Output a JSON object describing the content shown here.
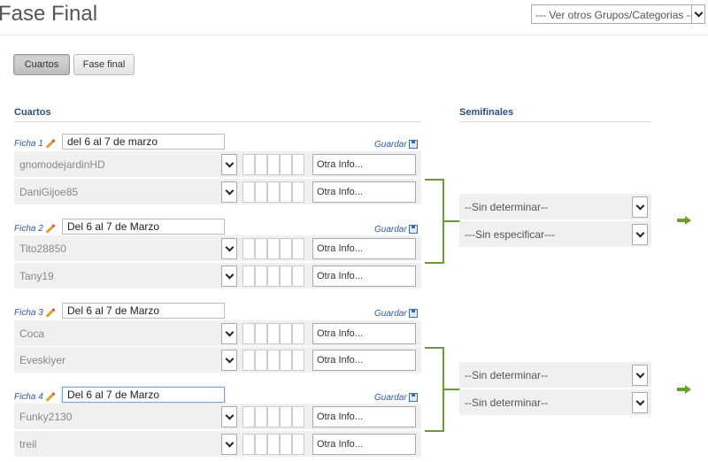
{
  "header": {
    "title": "Fase Final",
    "group_select": "--- Ver otros Grupos/Categorias ---"
  },
  "tabs": [
    {
      "label": "Cuartos",
      "active": true
    },
    {
      "label": "Fase final",
      "active": false
    }
  ],
  "sections": {
    "quarters_title": "Cuartos",
    "semis_title": "Semifinales"
  },
  "save_label": "Guardar",
  "matches": [
    {
      "label": "Ficha 1",
      "date": "del 6 al 7 de marzo",
      "players": [
        {
          "name": "gnomodejardinHD",
          "info": "Otra Info..."
        },
        {
          "name": "DaniGijoe85",
          "info": "Otra Info..."
        }
      ]
    },
    {
      "label": "Ficha 2",
      "date": "Del 6 al 7 de Marzo",
      "players": [
        {
          "name": "Tito28850",
          "info": "Otra Info..."
        },
        {
          "name": "Tany19",
          "info": "Otra Info..."
        }
      ]
    },
    {
      "label": "Ficha 3",
      "date": "Del 6 al 7 de Marzo",
      "players": [
        {
          "name": "Coca",
          "info": "Otra Info..."
        },
        {
          "name": "Eveskiyer",
          "info": "Otra Info..."
        }
      ]
    },
    {
      "label": "Ficha 4",
      "date": "Del 6 al 7 de Marzo",
      "players": [
        {
          "name": "Funky2130",
          "info": "Otra Info..."
        },
        {
          "name": "treil",
          "info": "Otra Info..."
        }
      ]
    }
  ],
  "semis": [
    {
      "name": "--Sin determinar--"
    },
    {
      "name": "---Sin especificar---"
    },
    {
      "name": "--Sin determinar--"
    },
    {
      "name": "--Sin determinar--"
    }
  ],
  "colors": {
    "accent": "#2b5aa0",
    "bracket": "#6a9a3a",
    "arrow": "#6aa02a"
  },
  "icons": [
    "pencil-icon",
    "save-icon",
    "chevron-down-icon",
    "arrow-right-icon"
  ]
}
